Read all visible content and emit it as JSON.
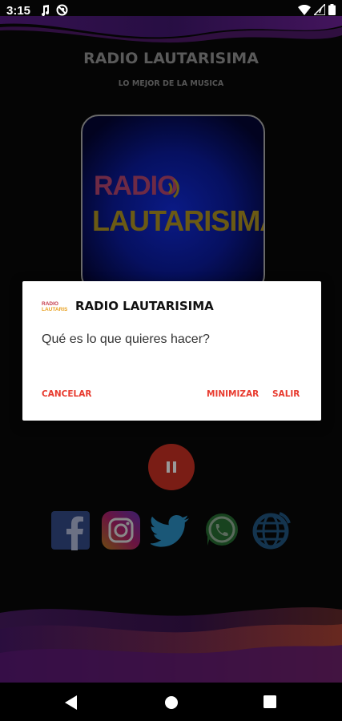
{
  "status_bar": {
    "time": "3:15"
  },
  "app": {
    "title": "RADIO LAUTARISIMA",
    "subtitle": "LO MEJOR DE LA MUSICA",
    "logo": {
      "line1": "RADIO",
      "line2": "LAUTARISIMA",
      "colors": {
        "line1": "#6e2a45",
        "line2": "#6b5a14",
        "background": "#0a1a86"
      }
    },
    "player_state": "playing",
    "social_icons": [
      "facebook-icon",
      "instagram-icon",
      "twitter-icon",
      "whatsapp-icon",
      "web-globe-icon"
    ]
  },
  "dialog": {
    "title": "RADIO LAUTARISIMA",
    "message": "Qué es lo que quieres hacer?",
    "buttons": {
      "cancel": "CANCELAR",
      "minimize": "MINIMIZAR",
      "exit": "SALIR"
    },
    "accent_color": "#e83a2e"
  },
  "nav_bar": {
    "icons": [
      "back-icon",
      "home-icon",
      "recents-icon"
    ]
  }
}
